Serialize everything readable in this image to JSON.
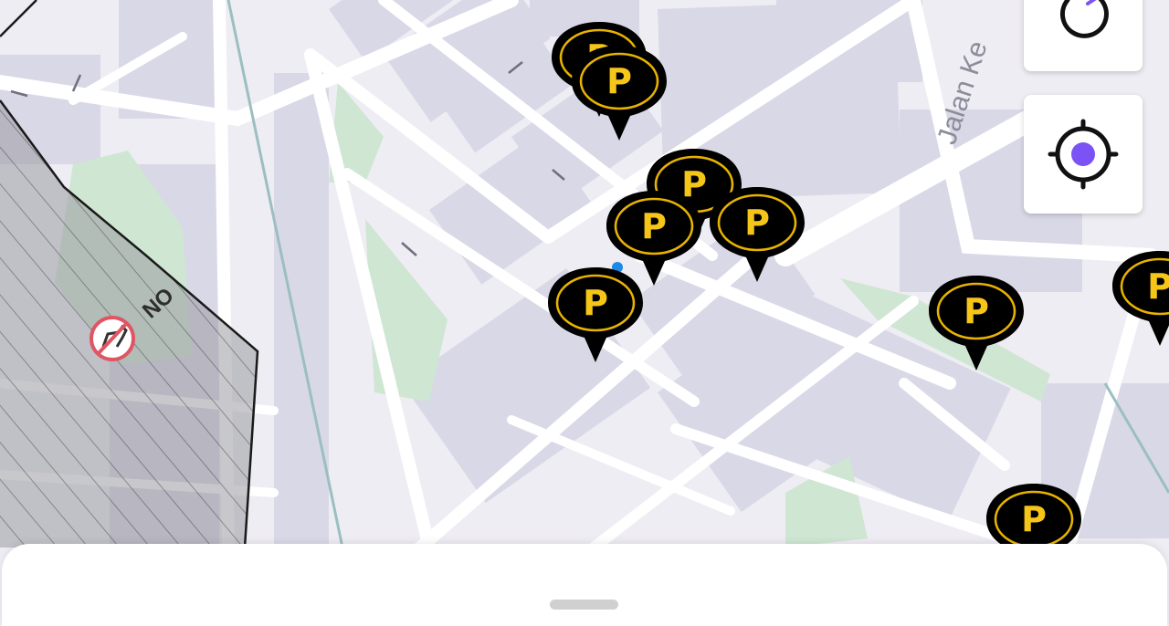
{
  "map": {
    "street_label": "Jalan Ke",
    "zone_label": "NO",
    "no_parking_icon": "no-dogs-sign-icon",
    "colors": {
      "background": "#eeedf3",
      "building": "#d9d8e6",
      "park": "#cfe6d3",
      "road": "#ffffff",
      "zone_fill": "#9a9aa3",
      "pin_fill": "#000000",
      "pin_ring": "#e8b300",
      "pin_text": "#f5c518",
      "location_dot": "#7b52f5"
    }
  },
  "parking_pins": [
    {
      "label": "P"
    },
    {
      "label": "P"
    },
    {
      "label": "P"
    },
    {
      "label": "P"
    },
    {
      "label": "P"
    },
    {
      "label": "P"
    },
    {
      "label": "P"
    },
    {
      "label": "P"
    },
    {
      "label": "P"
    }
  ],
  "controls": {
    "refresh": {
      "icon": "refresh-icon"
    },
    "locate": {
      "icon": "my-location-icon"
    }
  },
  "bottom_sheet": {
    "handle": "drag-handle"
  }
}
